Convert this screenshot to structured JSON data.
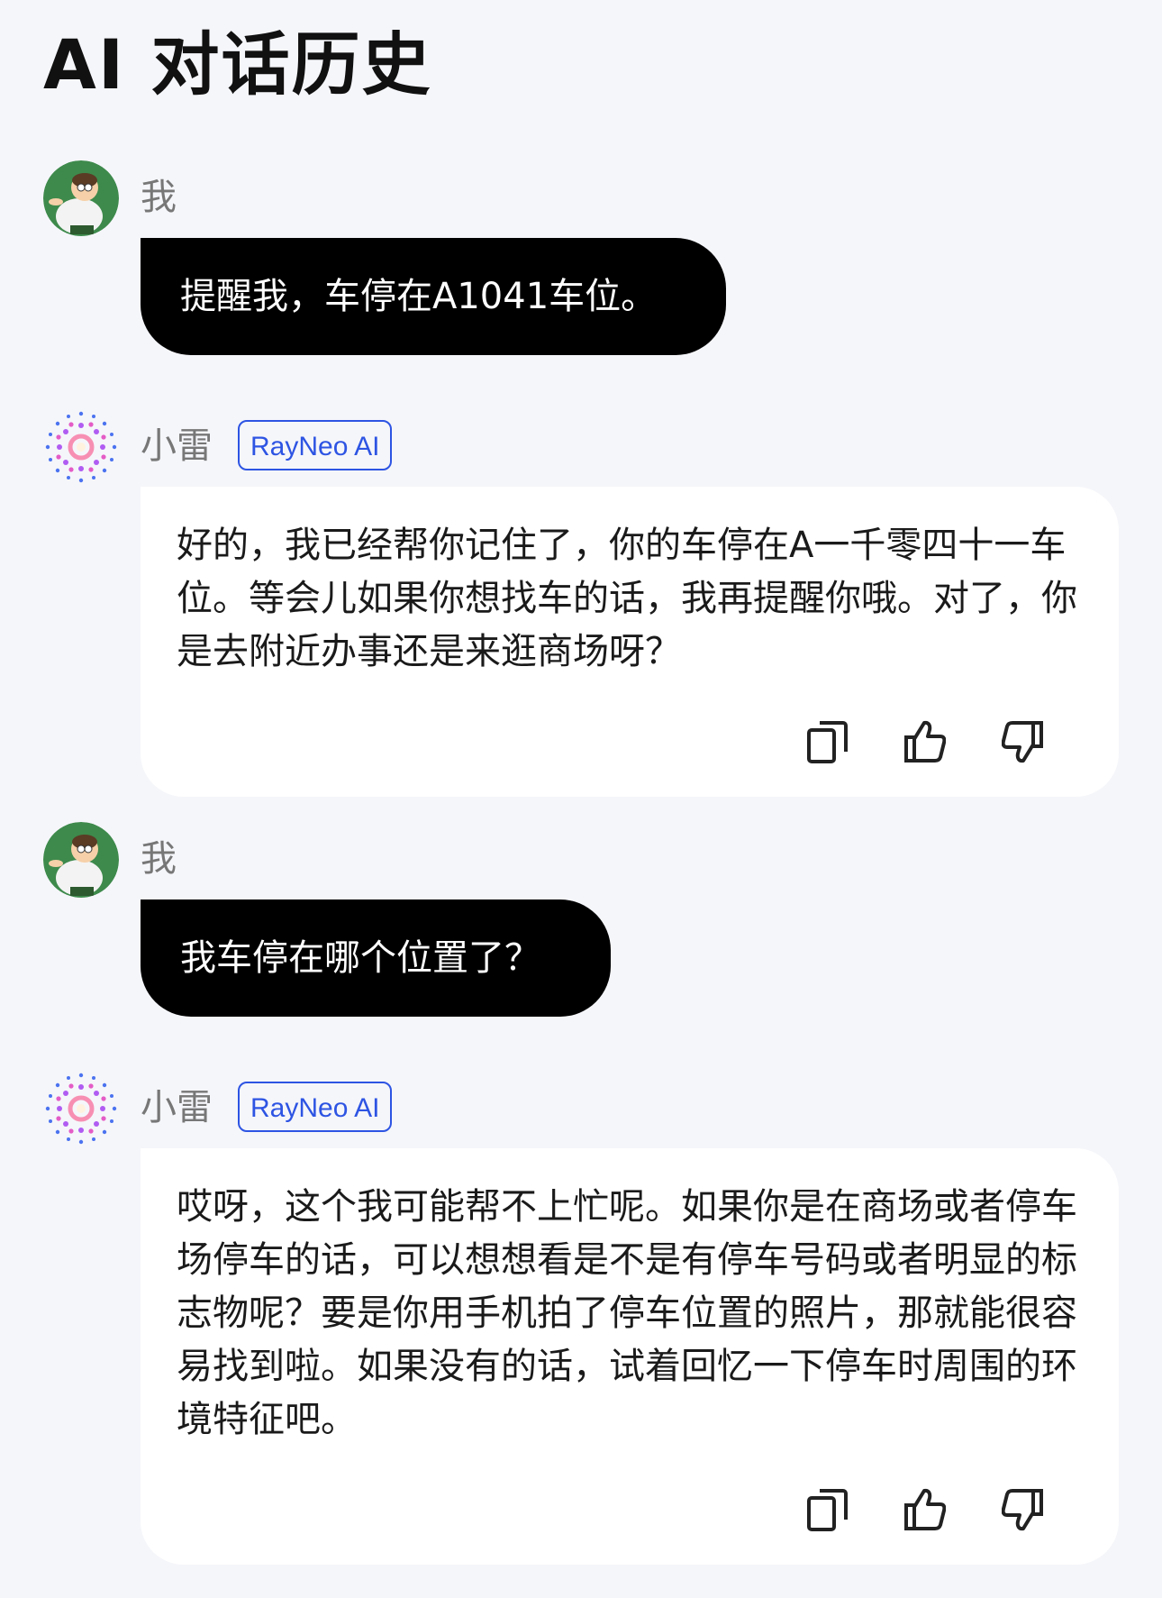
{
  "page": {
    "title": "AI 对话历史"
  },
  "user": {
    "name": "我"
  },
  "assistant": {
    "name": "小雷",
    "badge": "RayNeo AI"
  },
  "messages": [
    {
      "role": "user",
      "text": "提醒我，车停在A1041车位。"
    },
    {
      "role": "assistant",
      "text": "好的，我已经帮你记住了，你的车停在A一千零四十一车位。等会儿如果你想找车的话，我再提醒你哦。对了，你是去附近办事还是来逛商场呀？"
    },
    {
      "role": "user",
      "text": "我车停在哪个位置了？"
    },
    {
      "role": "assistant",
      "text": "哎呀，这个我可能帮不上忙呢。如果你是在商场或者停车场停车的话，可以想想看是不是有停车号码或者明显的标志物呢？要是你用手机拍了停车位置的照片，那就能很容易找到啦。如果没有的话，试着回忆一下停车时周围的环境特征吧。"
    }
  ],
  "icons": {
    "copy": "copy-icon",
    "like": "thumbs-up-icon",
    "dislike": "thumbs-down-icon"
  },
  "colors": {
    "background": "#f5f6fa",
    "user_bubble": "#000000",
    "ai_bubble": "#ffffff",
    "badge": "#2d54e3"
  }
}
